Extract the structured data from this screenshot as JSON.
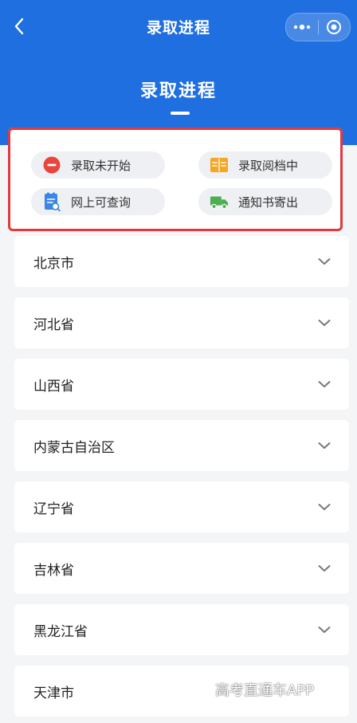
{
  "nav": {
    "title": "录取进程"
  },
  "header": {
    "title": "录取进程"
  },
  "legend": {
    "items": [
      {
        "label": "录取未开始",
        "icon": "minus-circle-icon",
        "color": "#e8453c"
      },
      {
        "label": "录取阅档中",
        "icon": "open-book-icon",
        "color": "#f5a623"
      },
      {
        "label": "网上可查询",
        "icon": "document-search-icon",
        "color": "#3a86e8"
      },
      {
        "label": "通知书寄出",
        "icon": "truck-icon",
        "color": "#4caf50"
      }
    ]
  },
  "regions": [
    {
      "label": "北京市"
    },
    {
      "label": "河北省"
    },
    {
      "label": "山西省"
    },
    {
      "label": "内蒙古自治区"
    },
    {
      "label": "辽宁省"
    },
    {
      "label": "吉林省"
    },
    {
      "label": "黑龙江省"
    },
    {
      "label": "天津市"
    }
  ],
  "watermark": "高考直通车APP",
  "colors": {
    "brand": "#1f6fe0",
    "highlight_border": "#e0393e",
    "background": "#f4f5f7"
  }
}
